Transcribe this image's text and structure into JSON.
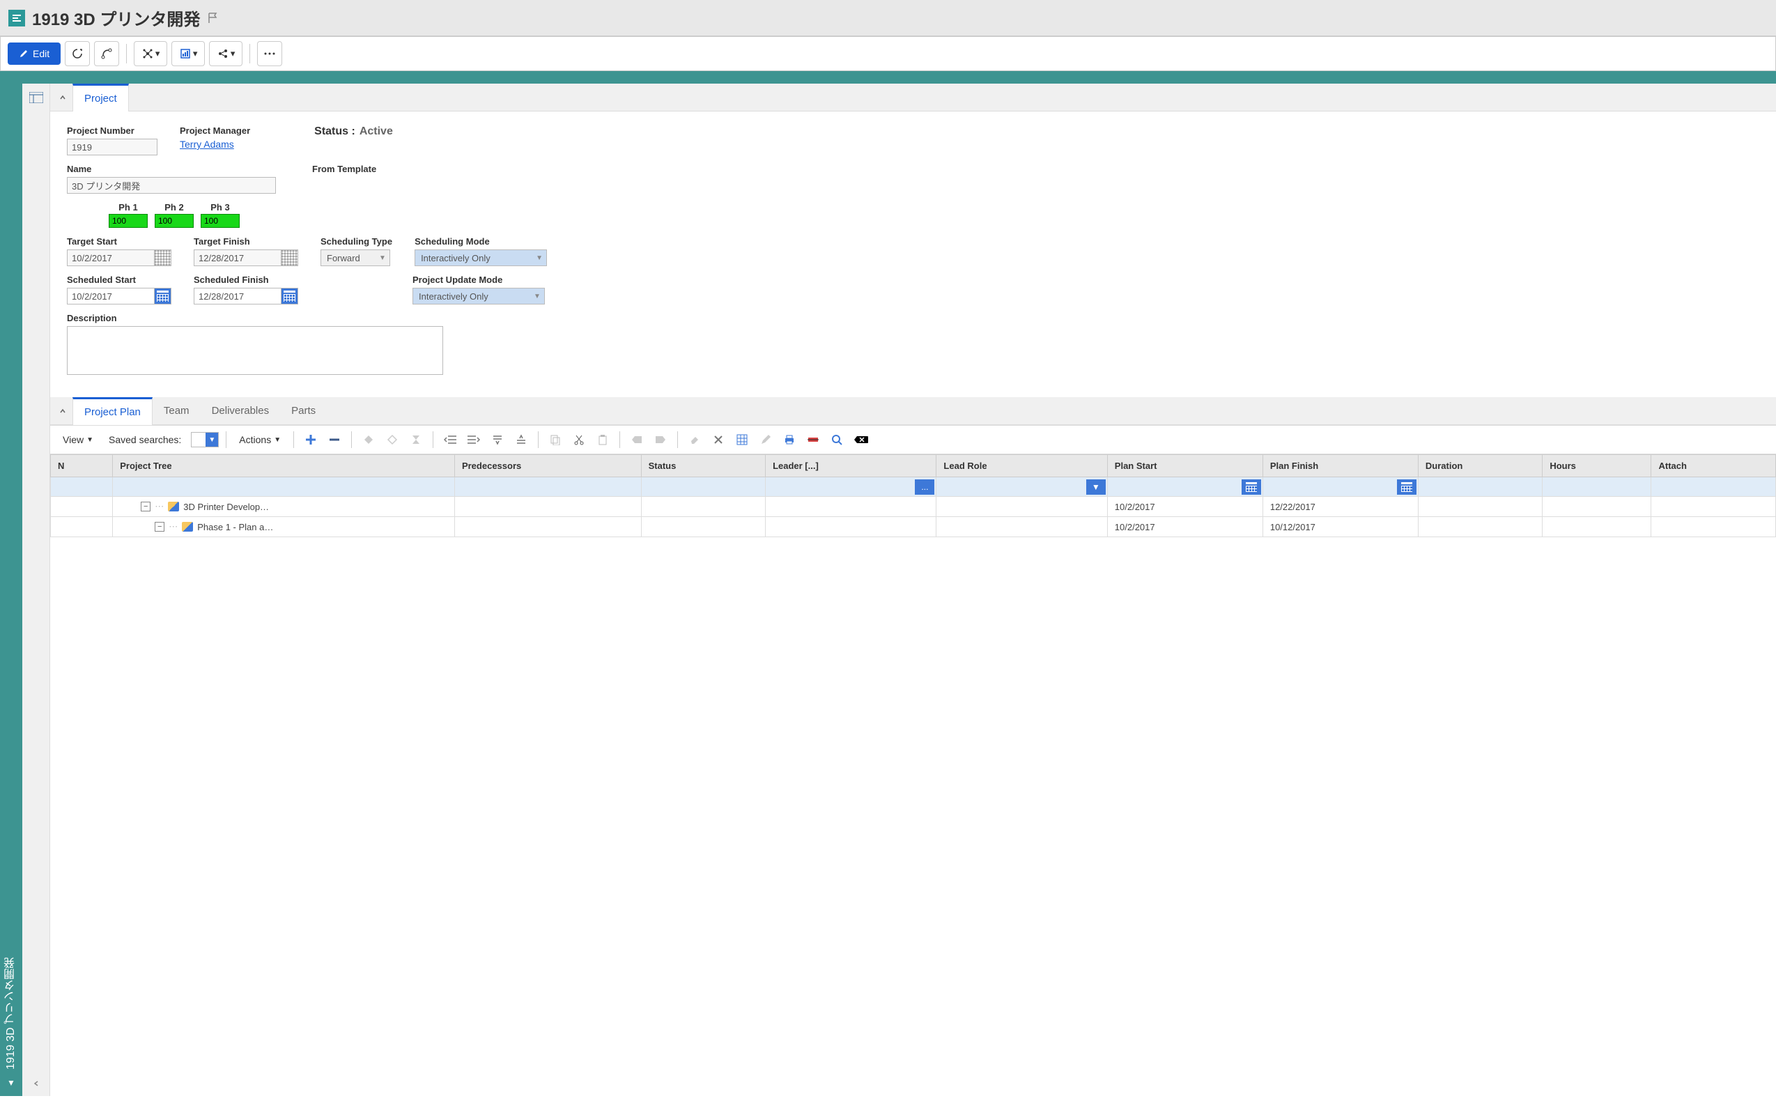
{
  "header": {
    "title": "1919 3D プリンタ開発"
  },
  "toolbar": {
    "edit_label": "Edit"
  },
  "vertical_tab": {
    "label": "1919 3D プリンタ開発"
  },
  "main_tabs": {
    "project": "Project"
  },
  "form": {
    "project_number_label": "Project Number",
    "project_number": "1919",
    "project_manager_label": "Project Manager",
    "project_manager": "Terry Adams",
    "name_label": "Name",
    "name": "3D プリンタ開発",
    "status_label": "Status :",
    "status_value": "Active",
    "from_template_label": "From Template",
    "phases": [
      {
        "label": "Ph 1",
        "value": "100"
      },
      {
        "label": "Ph 2",
        "value": "100"
      },
      {
        "label": "Ph 3",
        "value": "100"
      }
    ],
    "target_start_label": "Target Start",
    "target_start": "10/2/2017",
    "target_finish_label": "Target Finish",
    "target_finish": "12/28/2017",
    "scheduling_type_label": "Scheduling Type",
    "scheduling_type": "Forward",
    "scheduling_mode_label": "Scheduling Mode",
    "scheduling_mode": "Interactively Only",
    "scheduled_start_label": "Scheduled Start",
    "scheduled_start": "10/2/2017",
    "scheduled_finish_label": "Scheduled Finish",
    "scheduled_finish": "12/28/2017",
    "project_update_mode_label": "Project Update Mode",
    "project_update_mode": "Interactively Only",
    "description_label": "Description"
  },
  "sub_tabs": {
    "project_plan": "Project Plan",
    "team": "Team",
    "deliverables": "Deliverables",
    "parts": "Parts"
  },
  "grid_toolbar": {
    "view": "View",
    "saved_searches": "Saved searches:",
    "actions": "Actions"
  },
  "grid": {
    "columns": {
      "n": "N",
      "project_tree": "Project Tree",
      "predecessors": "Predecessors",
      "status": "Status",
      "leader": "Leader [...]",
      "lead_role": "Lead Role",
      "plan_start": "Plan Start",
      "plan_finish": "Plan Finish",
      "duration": "Duration",
      "hours": "Hours",
      "attach": "Attach"
    },
    "filter_ellipsis": "...",
    "rows": [
      {
        "indent": 0,
        "name": "3D Printer Develop…",
        "plan_start": "10/2/2017",
        "plan_finish": "12/22/2017"
      },
      {
        "indent": 1,
        "name": "Phase 1 - Plan a…",
        "plan_start": "10/2/2017",
        "plan_finish": "10/12/2017"
      }
    ]
  }
}
